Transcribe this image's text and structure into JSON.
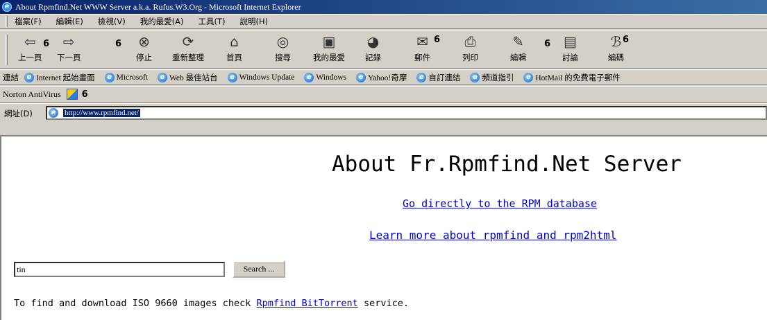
{
  "window": {
    "title": "About Rpmfind.Net WWW Server a.k.a. Rufus.W3.Org - Microsoft Internet Explorer"
  },
  "menu": [
    "檔案(F)",
    "編輯(E)",
    "檢視(V)",
    "我的最愛(A)",
    "工具(T)",
    "說明(H)"
  ],
  "toolbar": {
    "back": "上一頁",
    "forward": "下一頁",
    "stop": "停止",
    "refresh": "重新整理",
    "home": "首頁",
    "search": "搜尋",
    "favorites": "我的最愛",
    "history": "記錄",
    "mail": "郵件",
    "print": "列印",
    "edit": "編輯",
    "discuss": "討論",
    "encoding": "編碼",
    "dropdown_glyph": "6"
  },
  "links_bar": {
    "label": "連結",
    "items": [
      "Internet 起始畫面",
      "Microsoft",
      "Web 最佳站台",
      "Windows Update",
      "Windows",
      "Yahoo!奇摩",
      "自訂連結",
      "頻道指引",
      "HotMail 的免費電子郵件"
    ]
  },
  "norton": {
    "label": "Norton AntiVirus",
    "dropdown_glyph": "6"
  },
  "address": {
    "label": "網址(D)",
    "url": "http://www.rpmfind.net/"
  },
  "page": {
    "title": "About Fr.Rpmfind.Net Server",
    "link_rpm": "Go directly to the RPM database",
    "link_learn": "Learn more about rpmfind and rpm2html",
    "search_value": "tin",
    "search_button": "Search ...",
    "iso_prefix": "To find and download ISO 9660 images check ",
    "iso_link": "Rpmfind BitTorrent",
    "iso_suffix": " service."
  },
  "colors": {
    "title_bar": "#0a246a",
    "chrome": "#d4d0c8",
    "link": "#0000cc"
  }
}
